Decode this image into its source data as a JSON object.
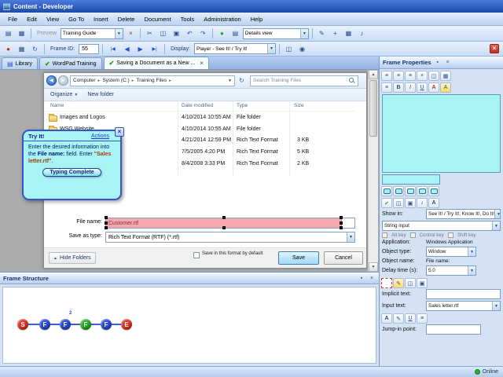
{
  "titlebar": {
    "title": "Content - Developer"
  },
  "menu": {
    "items": [
      "File",
      "Edit",
      "View",
      "Go To",
      "Insert",
      "Delete",
      "Document",
      "Tools",
      "Administration",
      "Help"
    ]
  },
  "toolbar1": {
    "preview": "Preview",
    "guide": "Training Guide",
    "view": "Details view"
  },
  "toolbar2": {
    "frame_id_label": "Frame ID:",
    "frame_id": "55",
    "display_label": "Display:",
    "display": "Player - See It! / Try It!"
  },
  "tabs": {
    "library": "Library",
    "wordpad": "WordPad Training",
    "active": "Saving a Document as a New ..."
  },
  "explorer": {
    "breadcrumb": [
      "Computer",
      "System (C:)",
      "Training Files"
    ],
    "search_placeholder": "Search Training Files",
    "organize": "Organize",
    "new_folder": "New folder",
    "columns": [
      "Name",
      "Date modified",
      "Type",
      "Size"
    ],
    "rows": [
      {
        "name": "Images and Logos",
        "date": "4/10/2014 10:55 AM",
        "type": "File folder",
        "size": ""
      },
      {
        "name": "WSG Website",
        "date": "4/10/2014 10:55 AM",
        "type": "File folder",
        "size": ""
      },
      {
        "name": "",
        "date": "4/21/2014 12:59 PM",
        "type": "Rich Text Format",
        "size": "3 KB"
      },
      {
        "name": "",
        "date": "7/5/2005 4:20 PM",
        "type": "Rich Text Format",
        "size": "5 KB"
      },
      {
        "name": "",
        "date": "8/4/2008 3:33 PM",
        "type": "Rich Text Format",
        "size": "2 KB"
      }
    ],
    "file_name_label": "File name:",
    "file_name": "Customer.rtf",
    "save_type_label": "Save as type:",
    "save_type": "Rich Text Format (RTF) (*.rtf)",
    "hide_folders": "Hide Folders",
    "default_format": "Save in this format by default",
    "save": "Save",
    "cancel": "Cancel"
  },
  "bubble": {
    "title": "Try It!",
    "actions": "Actions",
    "close": "×",
    "intro": "Enter the desired information into the ",
    "field": "File name:",
    "mid": " field. Enter ",
    "value": "\"Sales letter.rtf\"",
    "end": ".",
    "button": "Typing Complete"
  },
  "props": {
    "title": "Frame Properties",
    "show_in_label": "Show in:",
    "show_in": "See It! / Try It!, Know It!, Do It!",
    "input_type": "String input",
    "keys": [
      "Alt key",
      "Control key",
      "Shift key"
    ],
    "application_label": "Application:",
    "application": "Windows Application",
    "object_type_label": "Object type:",
    "object_type": "Window",
    "object_name_label": "Object name:",
    "object_name": "File name:",
    "delay_label": "Delay time (s):",
    "delay": "5.0",
    "implicit_label": "Implicit text:",
    "implicit": "",
    "input_text_label": "Input text:",
    "input_text": "Sales letter.rtf",
    "jump_label": "Jump-in point:",
    "jump": ""
  },
  "structure": {
    "title": "Frame Structure",
    "nodes": [
      {
        "label": "S",
        "color": "#e23222"
      },
      {
        "label": "F",
        "color": "#2a4ad8"
      },
      {
        "label": "F",
        "color": "#2a4ad8",
        "badge": "2"
      },
      {
        "label": "F",
        "color": "#23b223"
      },
      {
        "label": "F",
        "color": "#2a4ad8"
      },
      {
        "label": "E",
        "color": "#e23222"
      }
    ]
  },
  "status": {
    "online": "Online"
  },
  "colors": {
    "balloon": "#a8f4f4",
    "selection_highlight": "#f2a8ac",
    "online": "#22b030"
  },
  "icons": {
    "library": "▤",
    "new": "▦",
    "open": "▧",
    "cut": "✂",
    "copy": "◫",
    "paste": "▣",
    "undo": "↶",
    "redo": "↷",
    "record": "●",
    "refresh": "↻",
    "play": "▶",
    "clear": "×",
    "details": "▤",
    "edit": "✎",
    "plus": "+",
    "image": "▦",
    "sound": "♪",
    "camera": "◉",
    "nav_first": "|◀",
    "nav_prev": "◀",
    "nav_next": "▶",
    "nav_last": "▶|",
    "close": "×",
    "check": "✔",
    "pin": "▪",
    "bold": "B",
    "italic": "I",
    "underline": "U",
    "align": "≡",
    "font": "A",
    "back": "◀",
    "forward": "▶",
    "chevron_up": "▲",
    "dropdown": "▼",
    "crumb_sep": "▸"
  }
}
